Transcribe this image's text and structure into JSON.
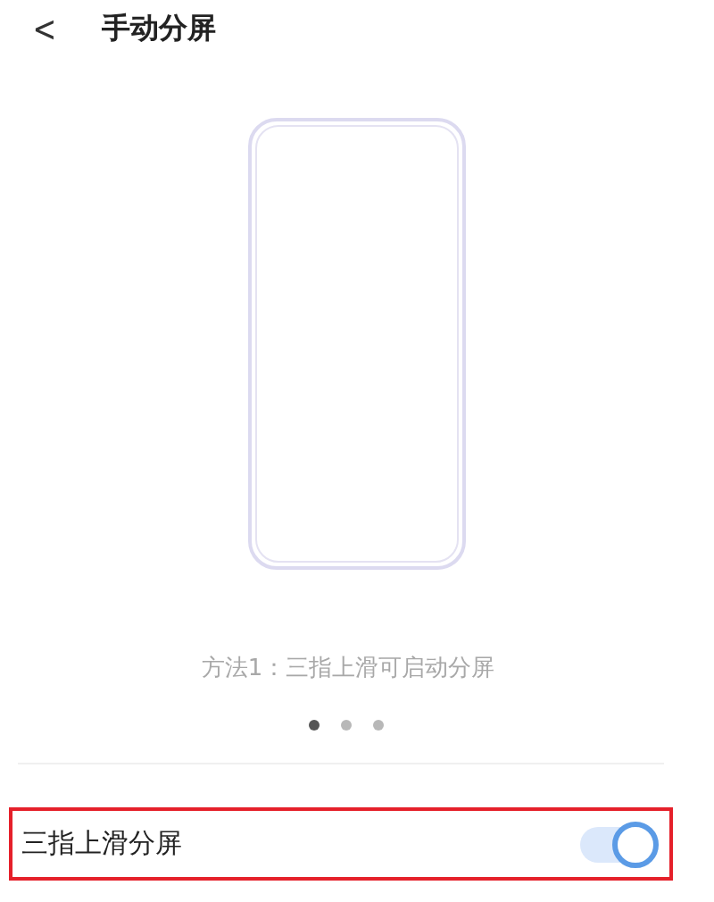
{
  "header": {
    "back": "<",
    "title": "手动分屏"
  },
  "carousel": {
    "caption": "方法1：三指上滑可启动分屏",
    "pages": [
      {
        "selected": true
      },
      {
        "selected": false
      },
      {
        "selected": false
      }
    ]
  },
  "setting": {
    "label": "三指上滑分屏",
    "on": true,
    "highlighted": true
  }
}
